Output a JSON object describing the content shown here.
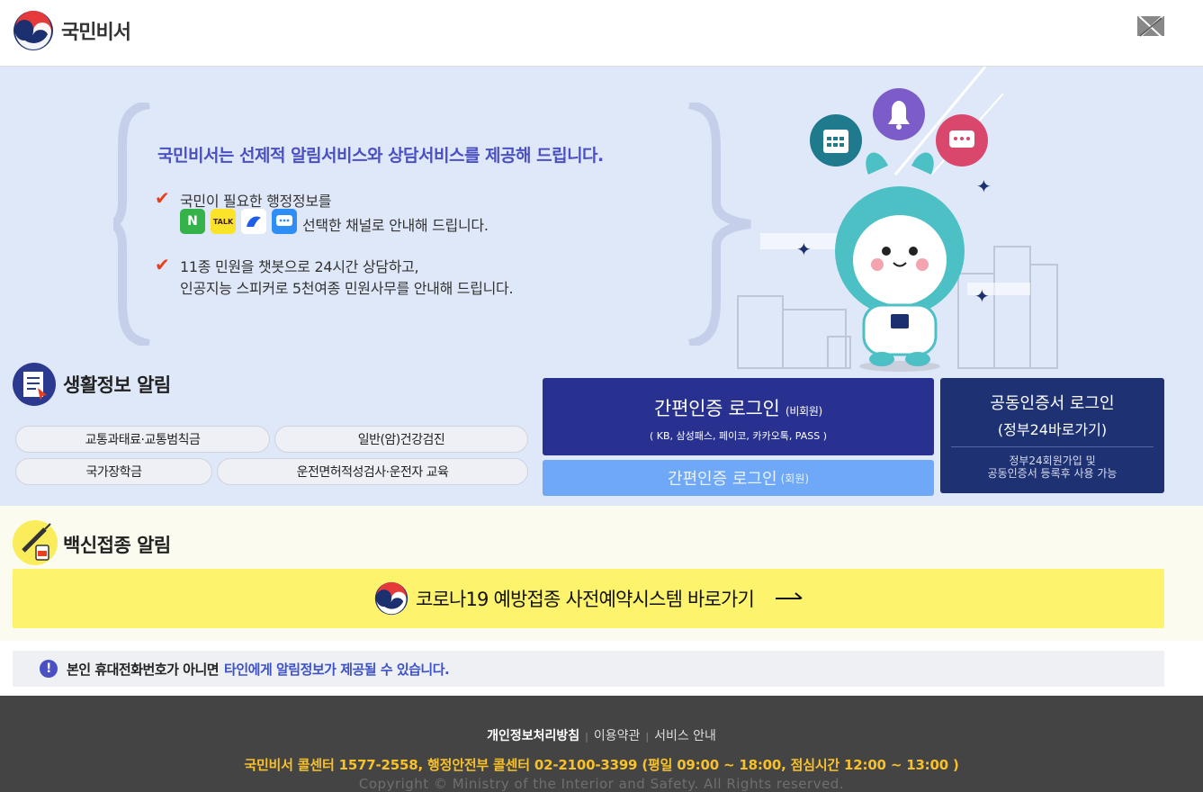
{
  "header": {
    "brand": "국민비서"
  },
  "hero": {
    "title": "국민비서는 선제적 알림서비스와 상담서비스를 제공해 드립니다.",
    "point1_line1": "국민이 필요한 행정정보를",
    "point1_line2": "선택한 채널로 안내해 드립니다.",
    "point2_line1": "11종 민원을 챗봇으로 24시간 상담하고,",
    "point2_line2": "인공지능 스피커로 5천여종 민원사무를 안내해 드립니다.",
    "channel_naver": "N",
    "channel_kakao": "TALK"
  },
  "life": {
    "title": "생활정보 알림",
    "items": [
      "교통과태료·교통범칙금",
      "일반(암)건강검진",
      "국가장학금",
      "운전면허적성검사·운전자 교육"
    ]
  },
  "login": {
    "simple_title": "간편인증 로그인",
    "simple_tag": "(비회원)",
    "simple_sub": "( KB, 삼성패스, 페이코, 카카오톡, PASS )",
    "member_title": "간편인증 로그인",
    "member_tag": "(회원)",
    "cert_line1": "공동인증서 로그인",
    "cert_line2": "(정부24바로가기)",
    "cert_note1": "정부24회원가입 및",
    "cert_note2": "공동인증서 등록후 사용 가능"
  },
  "vaccine": {
    "title": "백신접종 알림",
    "button": "코로나19 예방접종 사전예약시스템 바로가기"
  },
  "notice": {
    "part1": "본인 휴대전화번호가 아니면",
    "part2": "타인에게 알림정보가 제공될 수 있습니다."
  },
  "footer": {
    "privacy": "개인정보처리방침",
    "terms": "이용약관",
    "service": "서비스 안내",
    "callcenter": "국민비서 콜센터 1577-2558, 행정안전부 콜센터 02-2100-3399 (평일 09:00 ~ 18:00, 점심시간 12:00 ~ 13:00 )",
    "copyright": "Copyright © Ministry of the Interior and Safety. All Rights reserved."
  },
  "colors": {
    "accent": "#4a4fc2",
    "navy": "#28318f",
    "hero_bg": "#dfe8f8",
    "vaccine_yellow": "#fdf36c",
    "footer_bg": "#444444",
    "footer_highlight": "#f8c12a"
  }
}
